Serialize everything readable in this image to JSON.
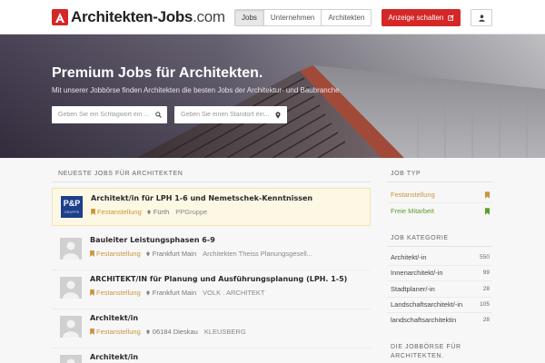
{
  "brand": {
    "name": "Architekten-Jobs",
    "tld": ".com",
    "color": "#d42727"
  },
  "nav": {
    "items": [
      {
        "label": "Jobs",
        "active": true
      },
      {
        "label": "Unternehmen",
        "active": false
      },
      {
        "label": "Architekten",
        "active": false
      }
    ],
    "cta_label": "Anzeige schalten",
    "cta_icon": "edit-icon",
    "user_icon": "user-icon"
  },
  "hero": {
    "title": "Premium Jobs für Architekten.",
    "subtitle": "Mit unserer Jobbörse finden Architekten die besten Jobs der Architektur- und Baubranche.",
    "keyword_placeholder": "Geben Sie ein Schlagwort ein ...",
    "location_placeholder": "Geben Sie einen Standort ein..."
  },
  "main": {
    "section_title": "Neueste Jobs für Architekten",
    "jobs": [
      {
        "title": "Architekt/in für LPH 1-6 und Nemetschek-Kenntnissen",
        "type": "Festanstellung",
        "location": "Fürth",
        "company": "PPGruppe",
        "featured": true,
        "logo_text": "P&P",
        "logo_sub": "GRUPPE"
      },
      {
        "title": "Bauleiter Leistungsphasen 6-9",
        "type": "Festanstellung",
        "location": "Frankfurt Main",
        "company": "Architekten Theiss Planungsgesell...",
        "featured": false
      },
      {
        "title": "ARCHITEKT/IN für Planung und Ausführungsplanung (LPH. 1-5)",
        "type": "Festanstellung",
        "location": "Frankfurt Main",
        "company": "VOLK . ARCHITEKT",
        "featured": false
      },
      {
        "title": "Architekt/in",
        "type": "Festanstellung",
        "location": "06184 Dieskau",
        "company": "KLEUSBERG",
        "featured": false
      },
      {
        "title": "Architekt/in",
        "type": "",
        "location": "",
        "company": "",
        "featured": false
      }
    ]
  },
  "sidebar": {
    "job_type_title": "Job Typ",
    "job_types": [
      {
        "label": "Festanstellung",
        "color": "#c9963c"
      },
      {
        "label": "Freie Mitarbeit",
        "color": "#5aa02c"
      }
    ],
    "category_title": "Job Kategorie",
    "categories": [
      {
        "label": "Architekt/-in",
        "count": "550"
      },
      {
        "label": "Innenarchitekt/-in",
        "count": "99"
      },
      {
        "label": "Stadtplaner/-in",
        "count": "28"
      },
      {
        "label": "Landschaftsarchitekt/-in",
        "count": "105"
      },
      {
        "label": "landschaftsarchitektin",
        "count": "28"
      }
    ],
    "about_title": "Die Jobbörse für Architekten."
  }
}
